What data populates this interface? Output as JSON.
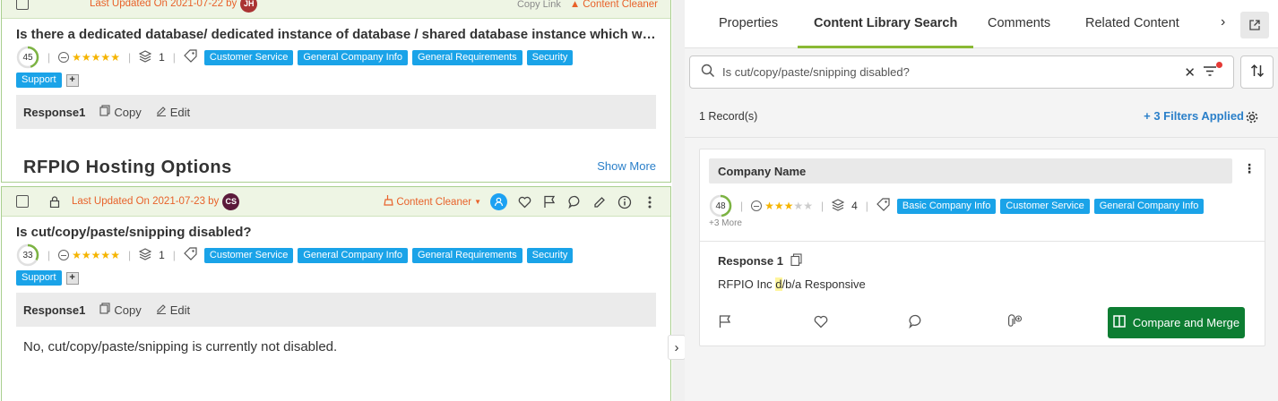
{
  "left": {
    "card1": {
      "updated_text": "Last Updated On 2021-07-22 by",
      "avatar": "JH",
      "copy_link": "Copy Link",
      "cleaner_label": "Content Cleaner",
      "question": "Is there a dedicated database/ dedicated instance of database / shared database instance which will ...",
      "score": "45",
      "score_fraction": 0.45,
      "stars": 5,
      "count": "1",
      "tags": [
        "Customer Service",
        "General Company Info",
        "General Requirements",
        "Security",
        "Support"
      ],
      "response_label": "Response1",
      "copy_label": "Copy",
      "edit_label": "Edit",
      "heading_cut": "RFPIO Hosting Options",
      "show_more": "Show More"
    },
    "card2": {
      "updated_text": "Last Updated On 2021-07-23 by",
      "avatar": "CS",
      "cleaner_label": "Content Cleaner",
      "question": "Is cut/copy/paste/snipping disabled?",
      "score": "33",
      "score_fraction": 0.33,
      "stars": 5,
      "count": "1",
      "tags": [
        "Customer Service",
        "General Company Info",
        "General Requirements",
        "Security",
        "Support"
      ],
      "response_label": "Response1",
      "copy_label": "Copy",
      "edit_label": "Edit",
      "answer": "No, cut/copy/paste/snipping is currently not disabled."
    }
  },
  "right": {
    "tabs": [
      "Properties",
      "Content Library Search",
      "Comments",
      "Related Content"
    ],
    "active_tab": 1,
    "search_value": "Is cut/copy/paste/snipping disabled?",
    "records": "1 Record(s)",
    "filters": "+ 3 Filters Applied",
    "result": {
      "header": "Company Name",
      "score": "48",
      "score_fraction": 0.48,
      "stars": 3,
      "count": "4",
      "tags": [
        "Basic Company Info",
        "Customer Service",
        "General Company Info"
      ],
      "more": "+3 More",
      "response_label": "Response 1",
      "answer_pre": "RFPIO Inc ",
      "answer_hl": "d",
      "answer_post": "/b/a Responsive",
      "merge_label": "Compare and Merge"
    }
  },
  "colors": {
    "accent_green": "#8ab934",
    "tag_blue": "#1aa3e8",
    "merge_green": "#0d7d32",
    "updated_orange": "#e8622a"
  }
}
